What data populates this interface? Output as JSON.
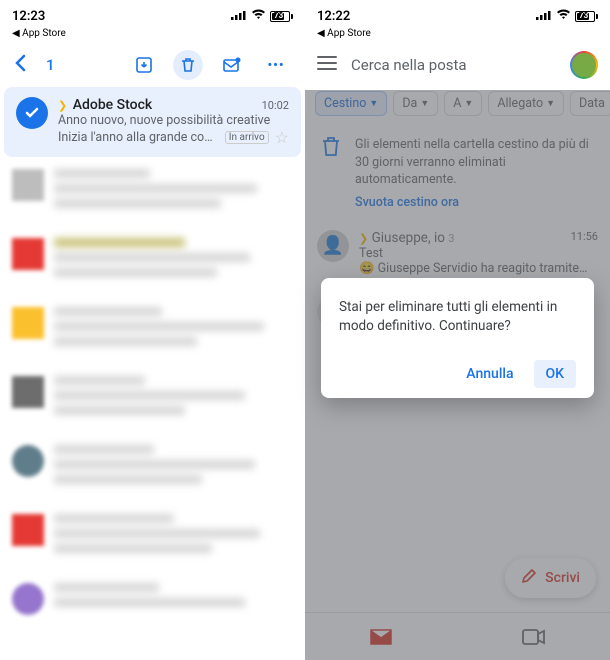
{
  "left": {
    "status": {
      "time": "12:23",
      "back": "App Store",
      "battery": "73"
    },
    "selection_count": "1",
    "mail": {
      "sender": "Adobe Stock",
      "time": "10:02",
      "subject": "Anno nuovo, nuove possibilità creative",
      "snippet": "Inizia l'anno alla grande con un…",
      "inbox_label": "In arrivo"
    }
  },
  "right": {
    "status": {
      "time": "12:22",
      "back": "App Store",
      "battery": "73"
    },
    "search_placeholder": "Cerca nella posta",
    "chips": {
      "trash": "Cestino",
      "from": "Da",
      "to": "A",
      "attach": "Allegato",
      "date": "Data"
    },
    "banner": {
      "text": "Gli elementi nella cartella cestino da più di 30 giorni verranno eliminati automaticamente.",
      "empty": "Svuota cestino ora"
    },
    "thread": {
      "from": "Giuseppe, io",
      "count": "3",
      "time": "11:56",
      "subject": "Test",
      "snippet": "😄 Giuseppe Servidio ha reagito tramite…"
    },
    "dialog": {
      "message": "Stai per eliminare tutti gli elementi in modo definitivo. Continuare?",
      "cancel": "Annulla",
      "ok": "OK"
    },
    "compose": "Scrivi"
  }
}
